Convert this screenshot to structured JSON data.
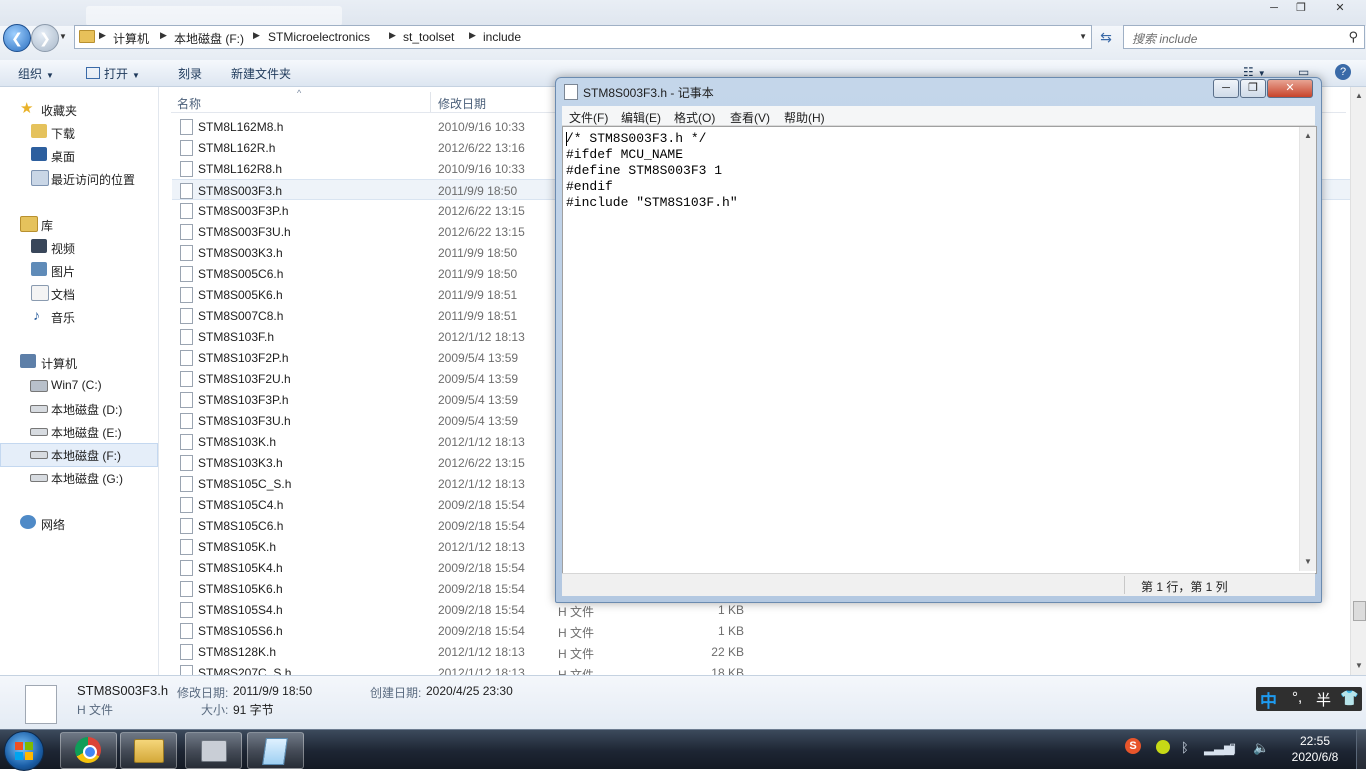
{
  "address": {
    "crumbs": [
      "计算机",
      "本地磁盘 (F:)",
      "STMicroelectronics",
      "st_toolset",
      "include"
    ],
    "search_placeholder": "搜索 include"
  },
  "toolbar": {
    "organize": "组织",
    "open": "打开",
    "burn": "刻录",
    "new_folder": "新建文件夹"
  },
  "nav": {
    "favorites": "收藏夹",
    "downloads": "下载",
    "desktop": "桌面",
    "recent": "最近访问的位置",
    "libraries": "库",
    "videos": "视频",
    "pictures": "图片",
    "documents": "文档",
    "music": "音乐",
    "computer": "计算机",
    "drives": [
      "Win7 (C:)",
      "本地磁盘 (D:)",
      "本地磁盘 (E:)",
      "本地磁盘 (F:)",
      "本地磁盘 (G:)"
    ],
    "network": "网络"
  },
  "columns": {
    "name": "名称",
    "modified": "修改日期"
  },
  "files": [
    {
      "name": "STM8L162M8.h",
      "date": "2010/9/16 10:33"
    },
    {
      "name": "STM8L162R.h",
      "date": "2012/6/22 13:16"
    },
    {
      "name": "STM8L162R8.h",
      "date": "2010/9/16 10:33"
    },
    {
      "name": "STM8S003F3.h",
      "date": "2011/9/9 18:50"
    },
    {
      "name": "STM8S003F3P.h",
      "date": "2012/6/22 13:15"
    },
    {
      "name": "STM8S003F3U.h",
      "date": "2012/6/22 13:15"
    },
    {
      "name": "STM8S003K3.h",
      "date": "2011/9/9 18:50"
    },
    {
      "name": "STM8S005C6.h",
      "date": "2011/9/9 18:50"
    },
    {
      "name": "STM8S005K6.h",
      "date": "2011/9/9 18:51"
    },
    {
      "name": "STM8S007C8.h",
      "date": "2011/9/9 18:51"
    },
    {
      "name": "STM8S103F.h",
      "date": "2012/1/12 18:13"
    },
    {
      "name": "STM8S103F2P.h",
      "date": "2009/5/4 13:59"
    },
    {
      "name": "STM8S103F2U.h",
      "date": "2009/5/4 13:59"
    },
    {
      "name": "STM8S103F3P.h",
      "date": "2009/5/4 13:59"
    },
    {
      "name": "STM8S103F3U.h",
      "date": "2009/5/4 13:59"
    },
    {
      "name": "STM8S103K.h",
      "date": "2012/1/12 18:13"
    },
    {
      "name": "STM8S103K3.h",
      "date": "2012/6/22 13:15"
    },
    {
      "name": "STM8S105C_S.h",
      "date": "2012/1/12 18:13"
    },
    {
      "name": "STM8S105C4.h",
      "date": "2009/2/18 15:54"
    },
    {
      "name": "STM8S105C6.h",
      "date": "2009/2/18 15:54"
    },
    {
      "name": "STM8S105K.h",
      "date": "2012/1/12 18:13"
    },
    {
      "name": "STM8S105K4.h",
      "date": "2009/2/18 15:54"
    },
    {
      "name": "STM8S105K6.h",
      "date": "2009/2/18 15:54"
    },
    {
      "name": "STM8S105S4.h",
      "date": "2009/2/18 15:54",
      "type": "H 文件",
      "size": "1 KB"
    },
    {
      "name": "STM8S105S6.h",
      "date": "2009/2/18 15:54",
      "type": "H 文件",
      "size": "1 KB"
    },
    {
      "name": "STM8S128K.h",
      "date": "2012/1/12 18:13",
      "type": "H 文件",
      "size": "22 KB"
    },
    {
      "name": "STM8S207C_S.h",
      "date": "2012/1/12 18:13",
      "type": "H 文件",
      "size": "18 KB"
    }
  ],
  "details": {
    "filename": "STM8S003F3.h",
    "type": "H 文件",
    "modified_label": "修改日期:",
    "modified": "2011/9/9 18:50",
    "created_label": "创建日期:",
    "created": "2020/4/25 23:30",
    "size_label": "大小:",
    "size": "91 字节"
  },
  "notepad": {
    "title": "STM8S003F3.h - 记事本",
    "menus": [
      "文件(F)",
      "编辑(E)",
      "格式(O)",
      "查看(V)",
      "帮助(H)"
    ],
    "content": "/* STM8S003F3.h */\n#ifdef MCU_NAME\n#define STM8S003F3 1\n#endif\n#include \"STM8S103F.h\"",
    "status": "第 1 行，第 1 列"
  },
  "ime": {
    "mode": "中",
    "punct": "°,",
    "width": "半"
  },
  "clock": {
    "time": "22:55",
    "date": "2020/6/8"
  },
  "icons": {
    "back": "back-arrow-icon",
    "forward": "forward-arrow-icon",
    "search": "search-icon",
    "refresh": "refresh-icon",
    "notepad": "notepad-icon",
    "chrome": "chrome-icon"
  },
  "colors": {
    "selection": "#e5eef9",
    "taskbar": "#1d2533",
    "accent": "#2a6ebf"
  }
}
